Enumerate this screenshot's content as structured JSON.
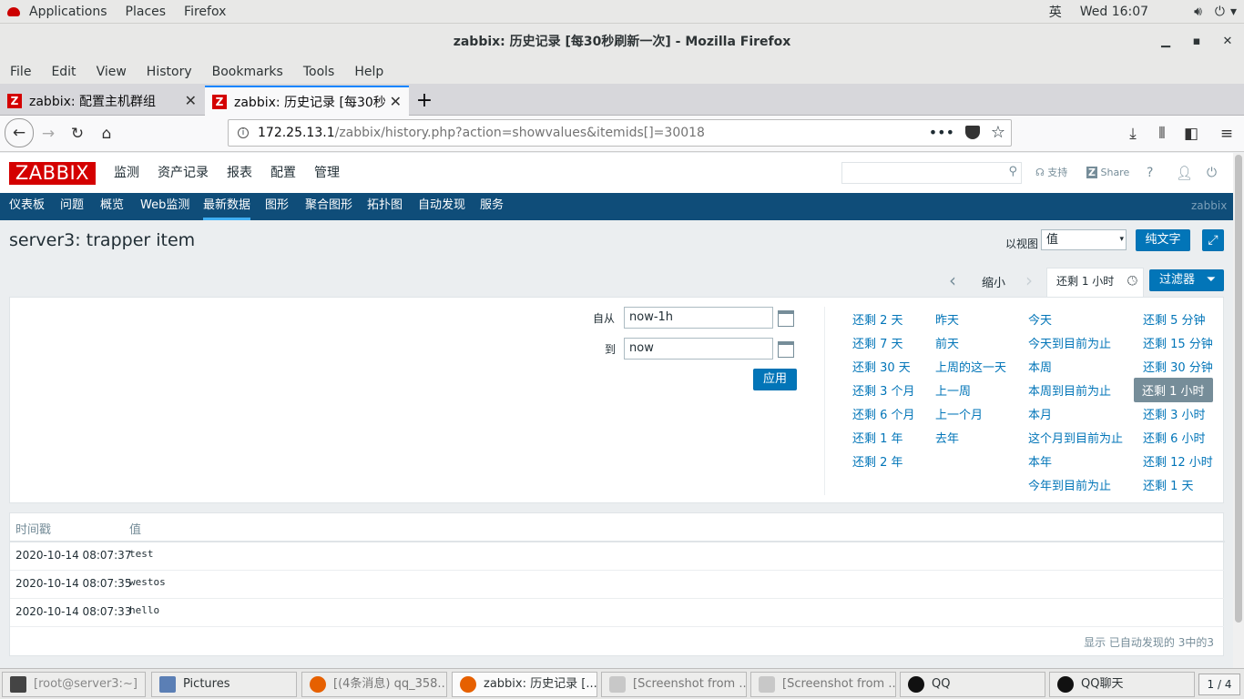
{
  "gnome": {
    "applications": "Applications",
    "places": "Places",
    "firefox": "Firefox",
    "ime": "英",
    "clock": "Wed 16:07"
  },
  "window": {
    "title": "zabbix: 历史记录 [每30秒刷新一次] - Mozilla Firefox",
    "min": "▁",
    "max": "▪",
    "close": "✕"
  },
  "menu": {
    "file": "File",
    "edit": "Edit",
    "view": "View",
    "history": "History",
    "bookmarks": "Bookmarks",
    "tools": "Tools",
    "help": "Help"
  },
  "tabs": [
    {
      "label": "zabbix: 配置主机群组",
      "icon": "Z"
    },
    {
      "label": "zabbix: 历史记录 [每30秒",
      "icon": "Z"
    }
  ],
  "url": {
    "host": "172.25.13.1",
    "path": "/zabbix/history.php?action=showvalues&itemids[]=30018"
  },
  "zabbix": {
    "logo": "ZABBIX",
    "top_menu": [
      "监测",
      "资产记录",
      "报表",
      "配置",
      "管理"
    ],
    "support": "支持",
    "share": "Share",
    "help": "?",
    "sub_menu": [
      "仪表板",
      "问题",
      "概览",
      "Web监测",
      "最新数据",
      "图形",
      "聚合图形",
      "拓扑图",
      "自动发现",
      "服务"
    ],
    "server_name": "zabbix"
  },
  "page": {
    "title": "server3: trapper item",
    "view_as_label": "以视图",
    "view_as_value": "值",
    "plaintext_button": "纯文字",
    "zoom_out": "缩小",
    "time_tab": "还剩 1 小时",
    "filter_button": "过滤器"
  },
  "filter": {
    "from_label": "自从",
    "from_value": "now-1h",
    "to_label": "到",
    "to_value": "now",
    "apply_button": "应用",
    "quick_ranges": [
      [
        "还剩 2 天",
        "还剩 7 天",
        "还剩 30 天",
        "还剩 3 个月",
        "还剩 6 个月",
        "还剩 1 年",
        "还剩 2 年"
      ],
      [
        "昨天",
        "前天",
        "上周的这一天",
        "上一周",
        "上一个月",
        "去年"
      ],
      [
        "今天",
        "今天到目前为止",
        "本周",
        "本周到目前为止",
        "本月",
        "这个月到目前为止",
        "本年",
        "今年到目前为止"
      ],
      [
        "还剩 5 分钟",
        "还剩 15 分钟",
        "还剩 30 分钟",
        "还剩 1 小时",
        "还剩 3 小时",
        "还剩 6 小时",
        "还剩 12 小时",
        "还剩 1 天"
      ]
    ]
  },
  "table": {
    "col_time": "时间戳",
    "col_value": "值",
    "rows": [
      {
        "time": "2020-10-14 08:07:37",
        "value": "test"
      },
      {
        "time": "2020-10-14 08:07:35",
        "value": "westos"
      },
      {
        "time": "2020-10-14 08:07:33",
        "value": "hello"
      }
    ],
    "footer": "显示 已自动发现的 3中的3"
  },
  "taskbar": [
    {
      "label": "[root@server3:~]"
    },
    {
      "label": "Pictures"
    },
    {
      "label": "[(4条消息) qq_358..."
    },
    {
      "label": "zabbix: 历史记录 [..."
    },
    {
      "label": "[Screenshot from ..."
    },
    {
      "label": "[Screenshot from ..."
    },
    {
      "label": "QQ"
    },
    {
      "label": "QQ聊天"
    }
  ],
  "workspace": "1 / 4"
}
